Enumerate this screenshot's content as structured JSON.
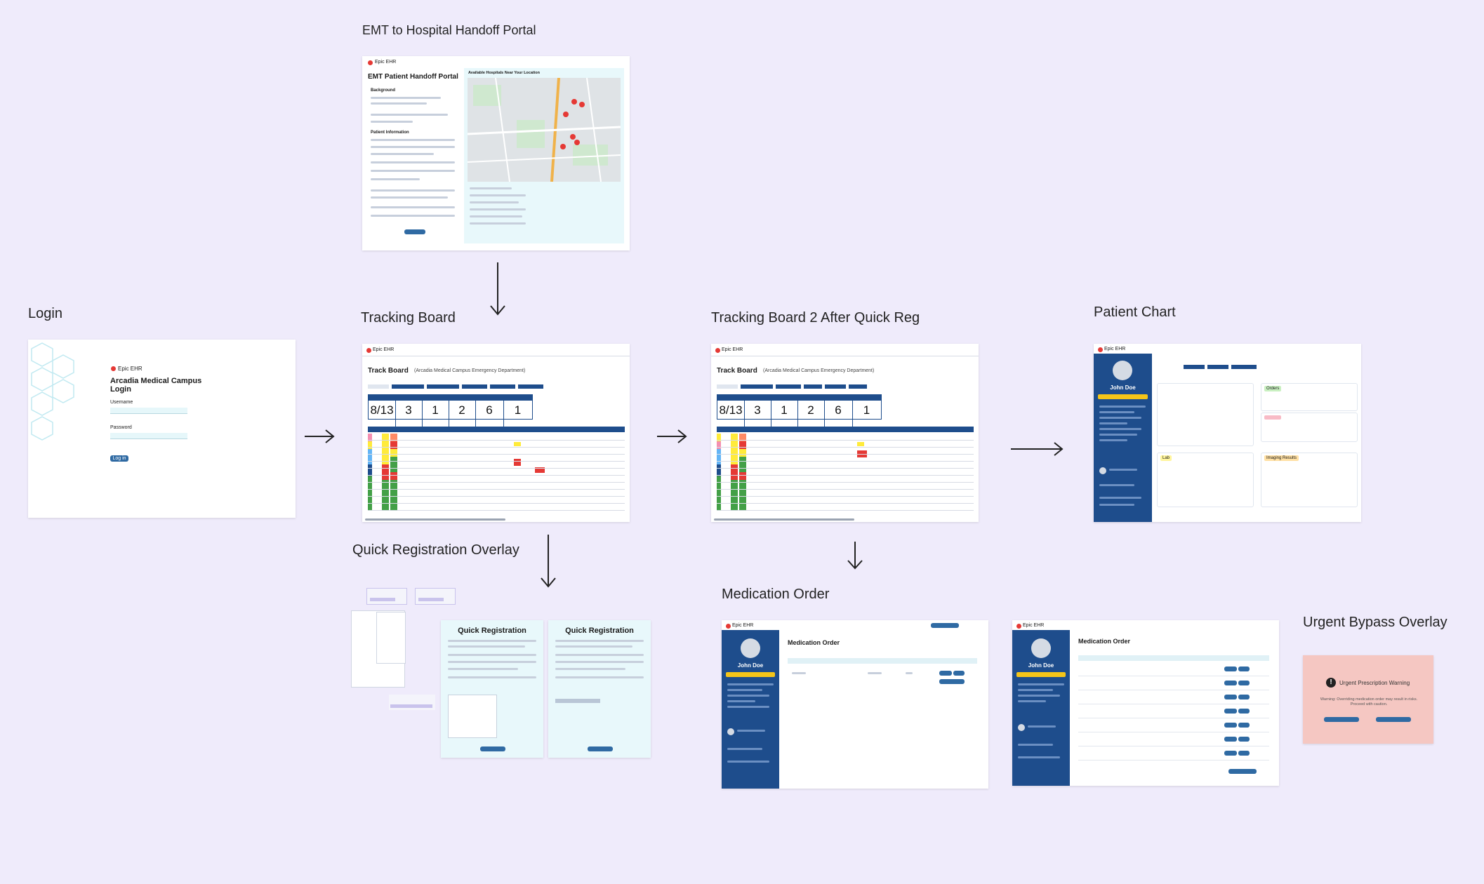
{
  "screens": {
    "emt": {
      "label": "EMT to Hospital Handoff Portal",
      "brand": "Epic EHR",
      "title": "EMT Patient Handoff Portal",
      "section_background": "Background",
      "section_patient": "Patient Information",
      "map_heading": "Available Hospitals Near Your Location"
    },
    "login": {
      "label": "Login",
      "brand": "Epic EHR",
      "title_line1": "Arcadia Medical Campus",
      "title_line2": "Login",
      "username_label": "Username",
      "password_label": "Password",
      "button": "Log in"
    },
    "tracking": {
      "label": "Tracking Board",
      "brand": "Epic EHR",
      "title": "Track Board",
      "subtitle": "(Arcadia Medical Campus Emergency Department)",
      "stats": [
        "8/13",
        "3",
        "1",
        "2",
        "6",
        "1"
      ]
    },
    "tracking2": {
      "label": "Tracking Board 2 After Quick Reg",
      "brand": "Epic EHR",
      "title": "Track Board",
      "subtitle": "(Arcadia Medical Campus Emergency Department)",
      "stats": [
        "8/13",
        "3",
        "1",
        "2",
        "6",
        "1"
      ]
    },
    "chart": {
      "label": "Patient Chart",
      "brand": "Epic EHR",
      "patient_name": "John Doe",
      "tags": [
        "Orders",
        "Lab",
        "Imaging Results"
      ]
    },
    "quickreg": {
      "label": "Quick Registration Overlay",
      "form_title_a": "Quick Registration",
      "form_title_b": "Quick Registration"
    },
    "medorder": {
      "label": "Medication Order",
      "brand": "Epic EHR",
      "patient_name": "John Doe",
      "title": "Medication Order"
    },
    "medorder2": {
      "brand": "Epic EHR",
      "patient_name": "John Doe",
      "title": "Medication Order"
    },
    "urgent": {
      "label": "Urgent Bypass Overlay",
      "title": "Urgent Prescription Warning",
      "body": "Warning: Overriding medication order may result in risks. Proceed with caution."
    }
  },
  "colors": {
    "background": "#efebfb",
    "brand_blue": "#1e4d8c",
    "accent_red": "#e53935",
    "badge_yellow": "#f5c518",
    "urgent_bg": "#f5c7c2",
    "panel_cyan": "#e8f8fb"
  }
}
